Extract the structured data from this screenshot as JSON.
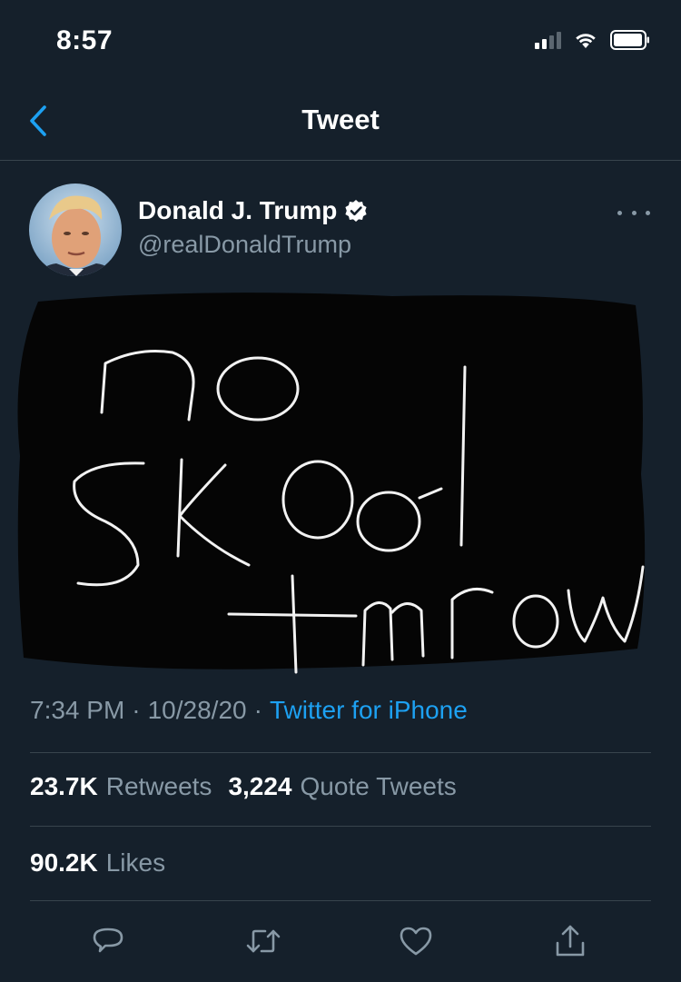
{
  "status_bar": {
    "time": "8:57"
  },
  "nav": {
    "title": "Tweet"
  },
  "tweet": {
    "author": {
      "display_name": "Donald J. Trump",
      "handle": "@realDonaldTrump",
      "verified": true
    },
    "media_text": "no skool tmrow",
    "time": "7:34 PM",
    "separator": "·",
    "date": "10/28/20",
    "source": "Twitter for iPhone"
  },
  "stats": {
    "retweets": {
      "value": "23.7K",
      "label": "Retweets"
    },
    "quote_tweets": {
      "value": "3,224",
      "label": "Quote Tweets"
    },
    "likes": {
      "value": "90.2K",
      "label": "Likes"
    }
  },
  "actions": [
    "reply-icon",
    "retweet-icon",
    "like-icon",
    "share-icon"
  ],
  "colors": {
    "background": "#15202b",
    "accent": "#1da1f2",
    "secondary_text": "#8899a6",
    "divider": "#38444d"
  }
}
